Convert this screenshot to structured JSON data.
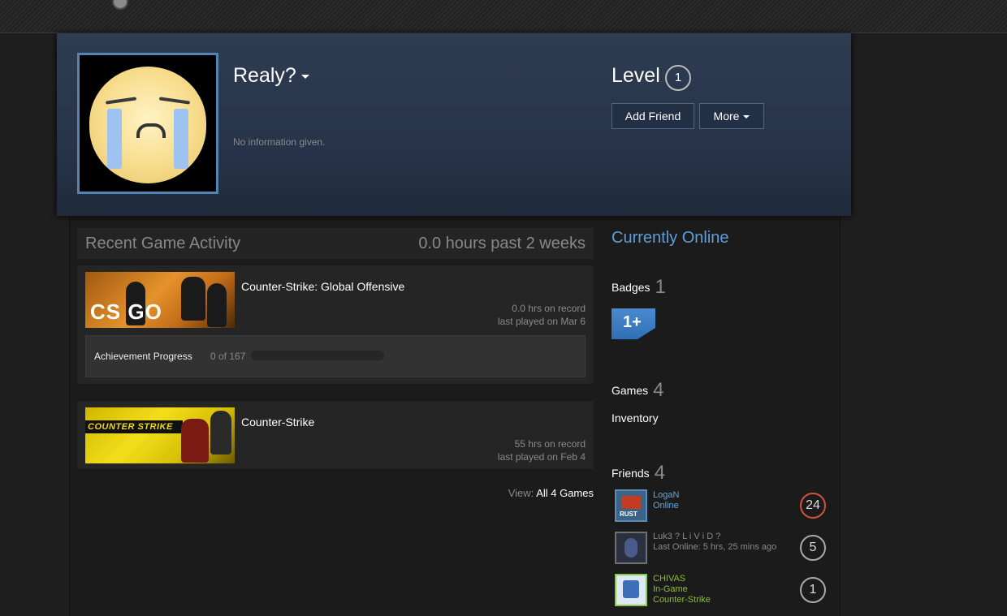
{
  "profile": {
    "persona_name": "Realy?",
    "summary": "No information given.",
    "level_label": "Level",
    "level": "1"
  },
  "actions": {
    "add_friend": "Add Friend",
    "more": "More"
  },
  "activity": {
    "title": "Recent Game Activity",
    "hours": "0.0 hours past 2 weeks",
    "games": [
      {
        "name": "Counter-Strike: Global Offensive",
        "capsule_text": "CS GO",
        "hours_on_record": "0.0 hrs on record",
        "last_played": "last played on Mar 6",
        "achievement_label": "Achievement Progress",
        "achievement_count": "0 of 167",
        "achievement_fraction": 0
      },
      {
        "name": "Counter-Strike",
        "capsule_text": "COUNTER STRIKE",
        "hours_on_record": "55 hrs on record",
        "last_played": "last played on Feb 4"
      }
    ],
    "view_label": "View:",
    "view_link": "All 4 Games"
  },
  "sidebar": {
    "status": "Currently Online",
    "badges_label": "Badges",
    "badges_count": "1",
    "badge_text": "1+",
    "games_label": "Games",
    "games_count": "4",
    "inventory_label": "Inventory",
    "friends_label": "Friends",
    "friends_count": "4",
    "friends": [
      {
        "name": "LogaN",
        "status": "Online",
        "game": "",
        "level": "24",
        "avatar_text": "RUST"
      },
      {
        "name": "Luk3 ? L i V i D ?",
        "status": "Last Online: 5 hrs, 25 mins ago",
        "game": "",
        "level": "5"
      },
      {
        "name": "CHIVAS",
        "status": "In-Game",
        "game": "Counter-Strike",
        "level": "1"
      }
    ]
  },
  "colors": {
    "accent_blue": "#5f9ed8",
    "online_blue": "#62a7e3",
    "ingame_green": "#90ba3c",
    "offline_gray": "#898989",
    "level_red": "#d2533a"
  }
}
